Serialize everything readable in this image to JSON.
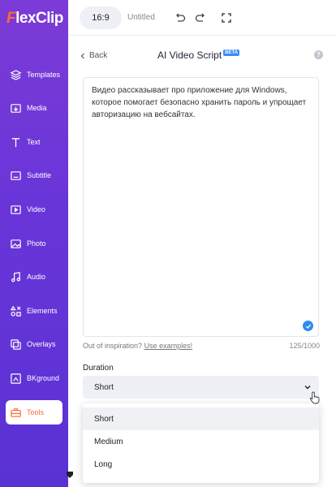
{
  "app": {
    "logo": "FlexClip"
  },
  "sidebar": {
    "items": [
      {
        "label": "Templates",
        "icon": "layers-icon"
      },
      {
        "label": "Media",
        "icon": "media-icon"
      },
      {
        "label": "Text",
        "icon": "text-icon"
      },
      {
        "label": "Subtitle",
        "icon": "subtitle-icon"
      },
      {
        "label": "Video",
        "icon": "video-icon"
      },
      {
        "label": "Photo",
        "icon": "photo-icon"
      },
      {
        "label": "Audio",
        "icon": "audio-icon"
      },
      {
        "label": "Elements",
        "icon": "elements-icon"
      },
      {
        "label": "Overlays",
        "icon": "overlays-icon"
      },
      {
        "label": "BKground",
        "icon": "background-icon"
      },
      {
        "label": "Tools",
        "icon": "toolbox-icon",
        "active": true
      }
    ]
  },
  "topbar": {
    "ratio": "16:9",
    "title": "Untitled"
  },
  "panel": {
    "back_label": "Back",
    "title": "AI Video Script",
    "badge": "BETA",
    "help": "?",
    "script_text": "Видео рассказывает про приложение для Windows, которое помогает безопасно хранить пароль и упрощает авторизацию на вебсайтах.",
    "inspiration_prefix": "Out of inspiration?",
    "inspiration_link": "Use examples!",
    "counter": "125/1000",
    "duration_label": "Duration",
    "duration_value": "Short",
    "duration_options": [
      "Short",
      "Medium",
      "Long"
    ]
  },
  "colors": {
    "accent": "#ff6b35",
    "sidebar": "#6a35d8",
    "check": "#2f8cf0"
  }
}
